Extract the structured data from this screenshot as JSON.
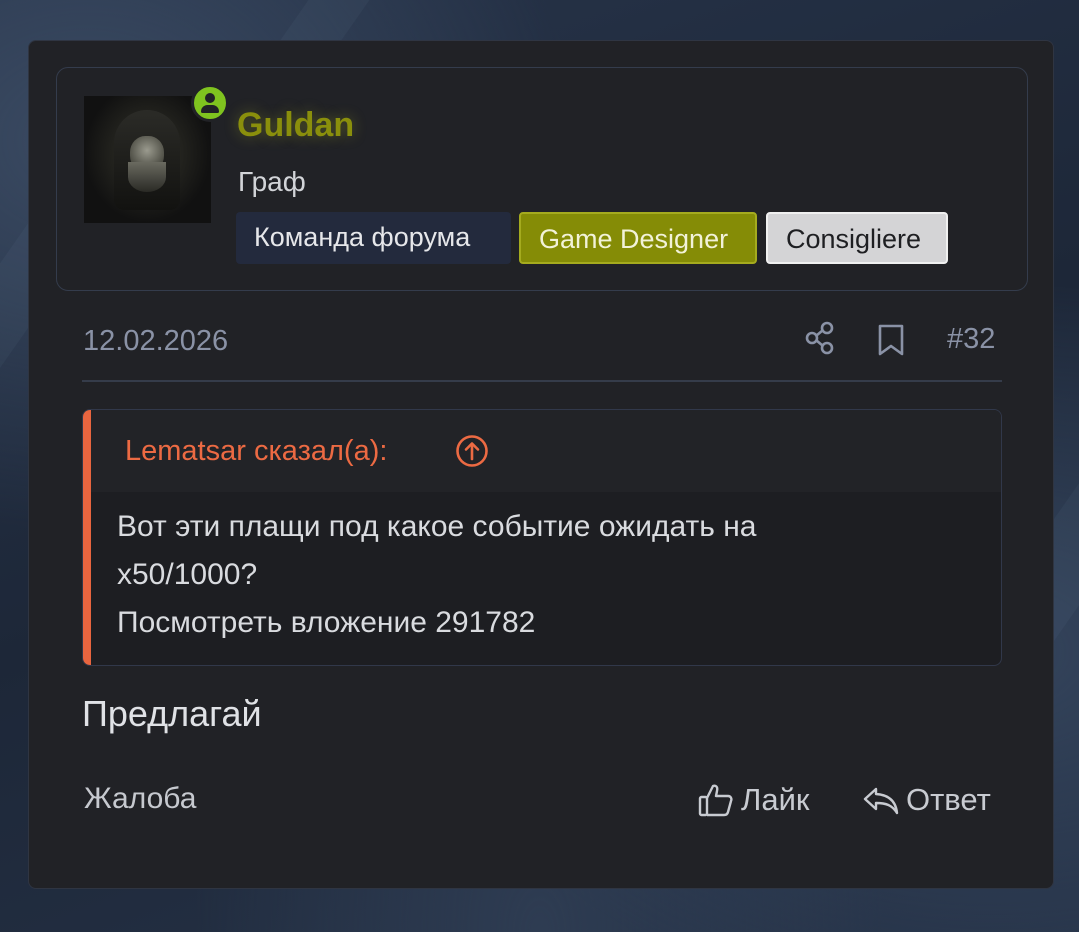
{
  "post": {
    "author": {
      "name": "Guldan",
      "title": "Граф",
      "badges": [
        "Команда форума",
        "Game Designer",
        "Consigliere"
      ],
      "name_color": "#8a8f0c",
      "online_icon": "user-online-icon"
    },
    "date": "12.02.2026",
    "number": "#32",
    "quote": {
      "author": "Lematsar сказал(а):",
      "lines": [
        "Вот эти плащи под какое событие ожидать на",
        "x50/1000?",
        "Посмотреть вложение 291782"
      ],
      "accent_color": "#e8653f"
    },
    "body": "Предлагай",
    "actions": {
      "report": "Жалоба",
      "like": "Лайк",
      "reply": "Ответ"
    }
  },
  "icons": {
    "share": "share-icon",
    "bookmark": "bookmark-icon",
    "quote_jump": "arrow-up-circle-icon",
    "like": "thumbs-up-icon",
    "reply": "reply-icon"
  }
}
